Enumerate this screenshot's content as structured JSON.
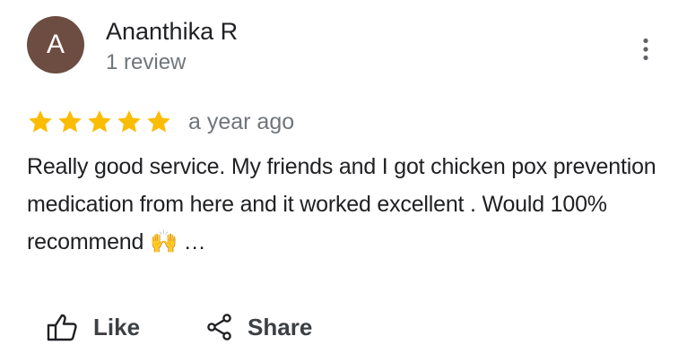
{
  "review": {
    "avatar_initial": "A",
    "avatar_color": "#6d4c41",
    "reviewer_name": "Ananthika R",
    "review_count": "1 review",
    "rating": 5,
    "rating_max": 5,
    "star_color": "#fbbc04",
    "time": "a year ago",
    "text": "Really good service. My friends and I got chicken pox prevention medication from here and it worked excellent . Would 100% recommend 🙌 …"
  },
  "actions": {
    "like_label": "Like",
    "share_label": "Share"
  },
  "icons": {
    "more": "more-vert-icon",
    "star": "star-icon",
    "like": "thumb-up-icon",
    "share": "share-icon"
  }
}
